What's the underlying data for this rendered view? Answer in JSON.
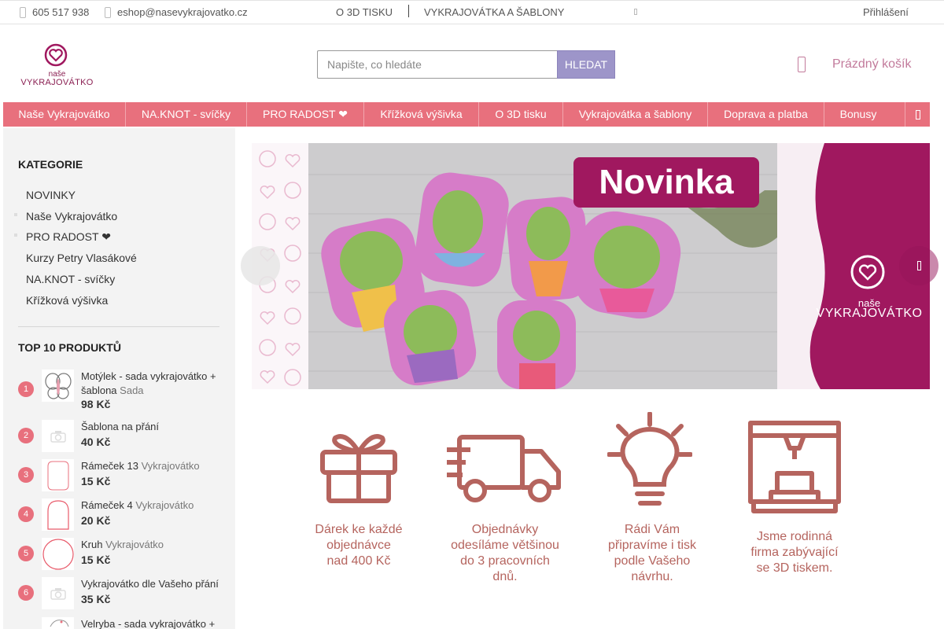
{
  "topbar": {
    "phone": "605 517 938",
    "email": "eshop@nasevykrajovatko.cz",
    "links": [
      "O 3D TISKU",
      "VYKRAJOVÁTKA A ŠABLONY"
    ],
    "login": "Přihlášení"
  },
  "header": {
    "logo_line1": "naše",
    "logo_line2": "VYKRAJOVÁTKO",
    "search_placeholder": "Napište, co hledáte",
    "search_button": "HLEDAT",
    "cart_label": "Prázdný košík"
  },
  "nav": {
    "items": [
      "Naše Vykrajovátko",
      "NA.KNOT - svíčky",
      "PRO RADOST ❤",
      "Křížková výšivka",
      "O 3D tisku",
      "Vykrajovátka a šablony",
      "Doprava a platba",
      "Bonusy"
    ]
  },
  "sidebar": {
    "categories_title": "KATEGORIE",
    "categories": [
      "NOVINKY",
      "Naše Vykrajovátko",
      "PRO RADOST ❤",
      "Kurzy Petry Vlasákové",
      "NA.KNOT - svíčky",
      "Křížková výšivka"
    ],
    "top_title": "TOP 10 PRODUKTŮ",
    "top_products": [
      {
        "rank": "1",
        "name": "Motýlek - sada vykrajovátko + šablona",
        "category": "Sada",
        "price": "98 Kč",
        "thumb": "butterfly-icon"
      },
      {
        "rank": "2",
        "name": "Šablona na přání",
        "category": "",
        "price": "40 Kč",
        "thumb": "camera-icon"
      },
      {
        "rank": "3",
        "name": "Rámeček 13",
        "category": "Vykrajovátko",
        "price": "15 Kč",
        "thumb": "frame-icon"
      },
      {
        "rank": "4",
        "name": "Rámeček 4",
        "category": "Vykrajovátko",
        "price": "20 Kč",
        "thumb": "arch-frame-icon"
      },
      {
        "rank": "5",
        "name": "Kruh",
        "category": "Vykrajovátko",
        "price": "15 Kč",
        "thumb": "circle-icon"
      },
      {
        "rank": "6",
        "name": "Vykrajovátko dle Vašeho přání",
        "category": "",
        "price": "35 Kč",
        "thumb": "camera-icon"
      },
      {
        "rank": "",
        "name": "Velryba - sada vykrajovátko +",
        "category": "",
        "price": "",
        "thumb": "whale-icon"
      }
    ]
  },
  "banner": {
    "badge": "Novinka",
    "brand_line1": "naše",
    "brand_line2": "VYKRAJOVÁTKO"
  },
  "benefits": [
    {
      "lines": [
        "Dárek ke každé",
        "objednávce",
        "nad 400 Kč"
      ],
      "icon": "gift-icon"
    },
    {
      "lines": [
        "Objednávky",
        "odesíláme většinou",
        "do 3 pracovních",
        "dnů."
      ],
      "icon": "truck-icon"
    },
    {
      "lines": [
        "Rádi Vám",
        "připravíme i tisk",
        "podle Vašeho",
        "návrhu."
      ],
      "icon": "lightbulb-icon"
    },
    {
      "lines": [
        "Jsme rodinná",
        "firma zabývající",
        "se 3D tiskem."
      ],
      "icon": "3d-printer-icon"
    }
  ],
  "colors": {
    "nav": "#e8707d",
    "brand": "#a0185f",
    "search_button": "#9d95c9",
    "benefit_text": "#b5645e"
  }
}
